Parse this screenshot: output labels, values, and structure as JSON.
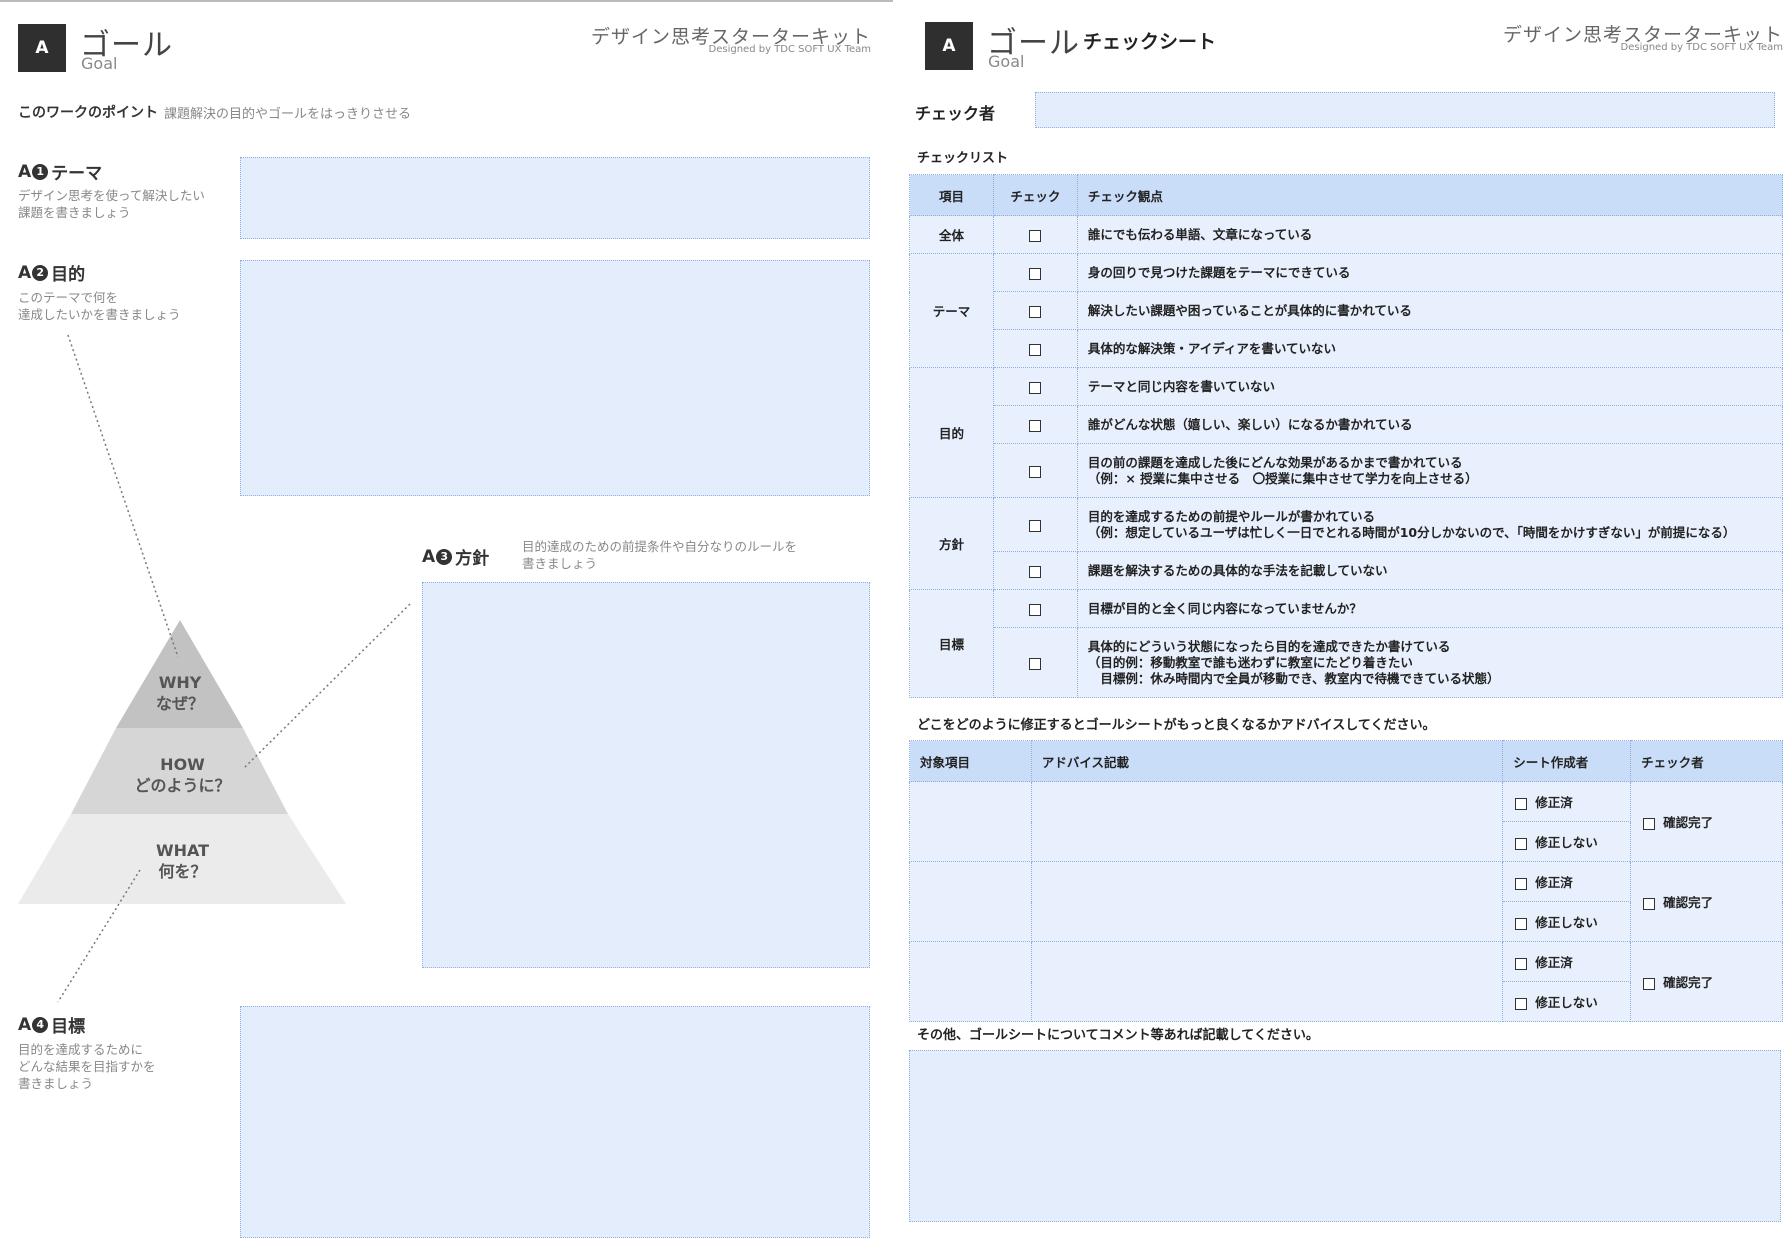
{
  "left": {
    "badge": "A",
    "title_jp": "ゴール",
    "title_en": "Goal",
    "kit_title": "デザイン思考スターターキット",
    "kit_sub": "Designed by TDC SOFT UX Team",
    "point_label": "このワークのポイント",
    "point_text": "課題解決の目的やゴールをはっきりさせる",
    "sections": [
      {
        "prefix": "A",
        "num": "1",
        "title": "テーマ",
        "desc": "デザイン思考を使って解決したい\n課題を書きましょう"
      },
      {
        "prefix": "A",
        "num": "2",
        "title": "目的",
        "desc": "このテーマで何を\n達成したいかを書きましょう"
      },
      {
        "prefix": "A",
        "num": "3",
        "title": "方針",
        "desc": "目的達成のための前提条件や自分なりのルールを\n書きましょう"
      },
      {
        "prefix": "A",
        "num": "4",
        "title": "目標",
        "desc": "目的を達成するために\nどんな結果を目指すかを\n書きましょう"
      }
    ],
    "pyramid": {
      "why": "WHY\nなぜ？",
      "how": "HOW\nどのように？",
      "what": "WHAT\n何を？"
    }
  },
  "right": {
    "badge": "A",
    "title_jp": "ゴール",
    "title_sub": "チェックシート",
    "title_en": "Goal",
    "kit_title": "デザイン思考スターターキット",
    "kit_sub": "Designed by TDC SOFT UX Team",
    "checker_label": "チェック者",
    "checklist_label": "チェックリスト",
    "checklist_headers": [
      "項目",
      "チェック",
      "チェック観点"
    ],
    "checklist_groups": [
      {
        "category": "全体",
        "items": [
          "誰にでも伝わる単語、文章になっている"
        ]
      },
      {
        "category": "テーマ",
        "items": [
          "身の回りで見つけた課題をテーマにできている",
          "解決したい課題や困っていることが具体的に書かれている",
          "具体的な解決策・アイディアを書いていない"
        ]
      },
      {
        "category": "目的",
        "items": [
          "テーマと同じ内容を書いていない",
          "誰がどんな状態（嬉しい、楽しい）になるか書かれている",
          "目の前の課題を達成した後にどんな効果があるかまで書かれている\n（例：× 授業に集中させる　〇授業に集中させて学力を向上させる）"
        ]
      },
      {
        "category": "方針",
        "items": [
          "目的を達成するための前提やルールが書かれている\n（例：想定しているユーザは忙しく一日でとれる時間が10分しかないので、「時間をかけすぎない」が前提になる）",
          "課題を解決するための具体的な手法を記載していない"
        ]
      },
      {
        "category": "目標",
        "items": [
          "目標が目的と全く同じ内容になっていませんか？",
          "具体的にどういう状態になったら目的を達成できたか書けている\n（目的例：移動教室で誰も迷わずに教室にたどり着きたい\n　目標例：休み時間内で全員が移動でき、教室内で待機できている状態）"
        ]
      }
    ],
    "advice_label": "どこをどのように修正するとゴールシートがもっと良くなるかアドバイスしてください。",
    "advice_headers": [
      "対象項目",
      "アドバイス記載",
      "シート作成者",
      "チェック者"
    ],
    "advice_rows": [
      {
        "opt1": "修正済",
        "opt2": "修正しない",
        "confirm": "確認完了"
      },
      {
        "opt1": "修正済",
        "opt2": "修正しない",
        "confirm": "確認完了"
      },
      {
        "opt1": "修正済",
        "opt2": "修正しない",
        "confirm": "確認完了"
      }
    ],
    "comment_label": "その他、ゴールシートについてコメント等あれば記載してください。"
  },
  "colors": {
    "box_fill": "#e4edfc",
    "box_border": "#8fb0e0",
    "header_fill": "#c9dcf8",
    "badge": "#2f2f2f"
  }
}
